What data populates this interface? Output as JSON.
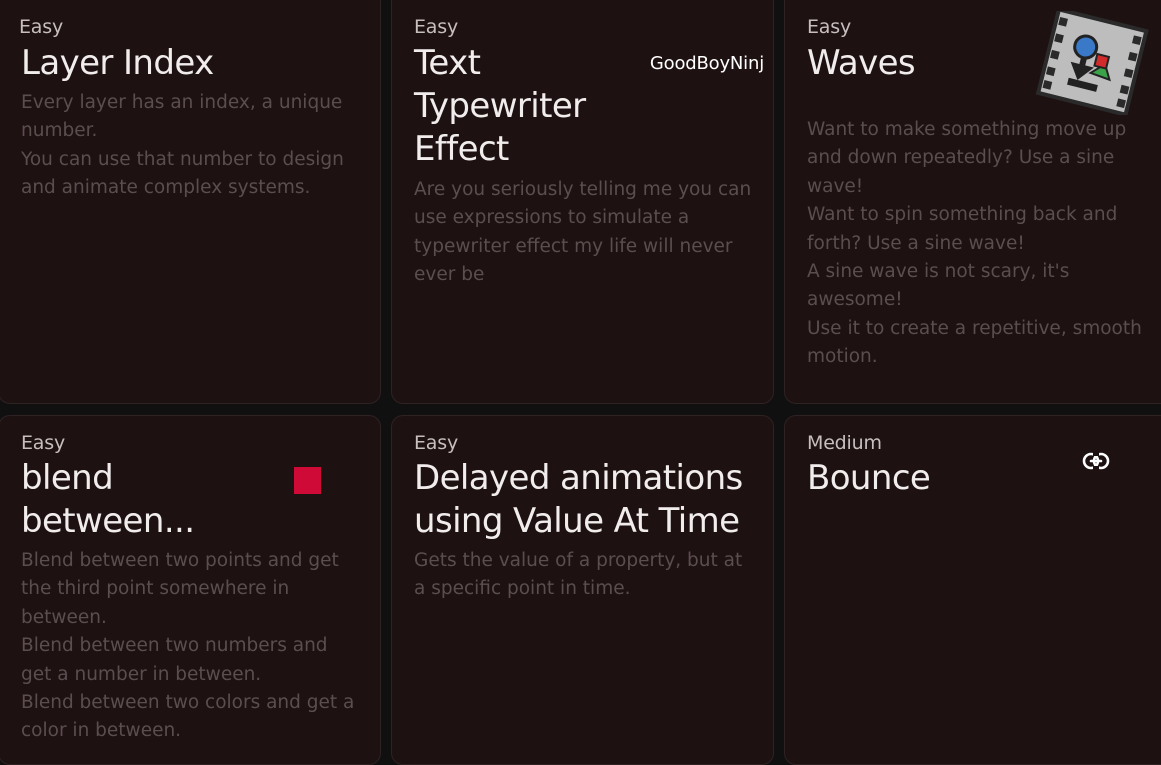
{
  "cards": [
    {
      "level": "Easy",
      "title": "Layer Index",
      "description": [
        "Every layer has an index, a unique number.",
        "You can use that number to design and animate complex systems."
      ]
    },
    {
      "level": "Easy",
      "title": "Text Typewriter Effect",
      "author": "GoodBoyNinj",
      "description": [
        "Are you seriously telling me you can use expressions to simulate a typewriter effect my life will never ever be"
      ]
    },
    {
      "level": "Easy",
      "title": "Waves",
      "icon": "after-effects-logo-icon",
      "description": [
        "Want to make something move up and down repeatedly? Use a sine wave!",
        "Want to spin something back and forth? Use a sine wave!",
        "A sine wave is not scary, it's awesome!",
        "Use it to create a repetitive, smooth motion."
      ]
    },
    {
      "level": "Easy",
      "title": "blend between...",
      "accent_color": "#cf0a36",
      "description": [
        "Blend between two points and get the third point somewhere in between.",
        "Blend between two numbers and get a number in between.",
        "Blend between two colors and get a color in between."
      ]
    },
    {
      "level": "Easy",
      "title": "Delayed animations using Value At Time",
      "description": [
        "Gets the value of a property, but at a specific point in time."
      ]
    },
    {
      "level": "Medium",
      "title": "Bounce",
      "icon": "link-icon",
      "description": []
    }
  ]
}
